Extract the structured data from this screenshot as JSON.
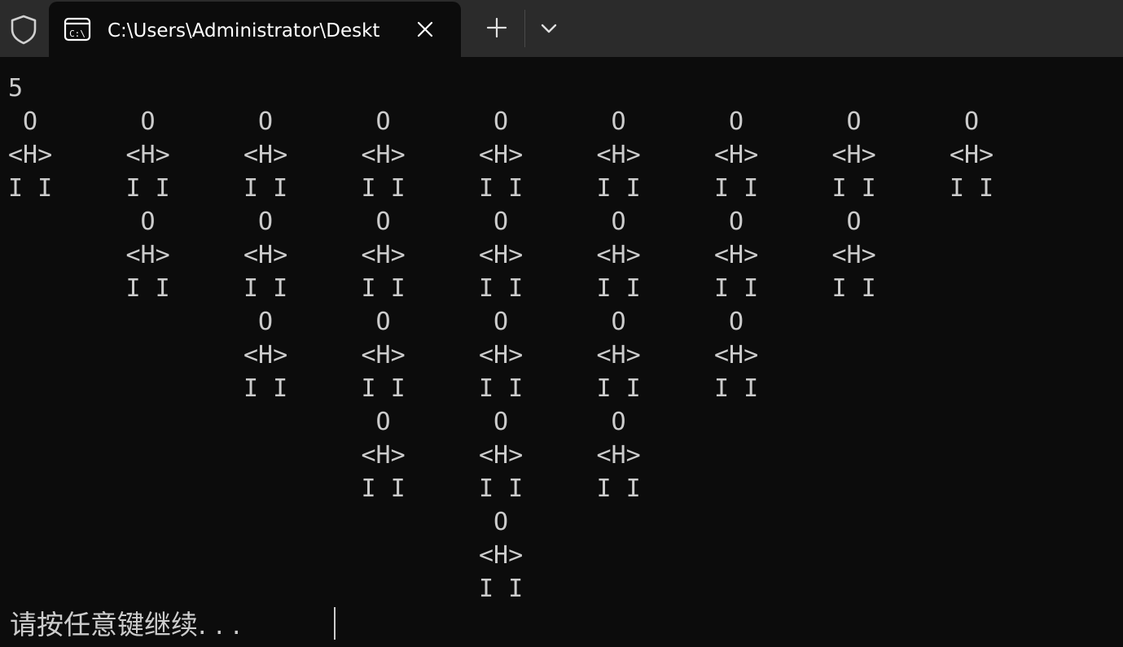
{
  "tab": {
    "icon": "terminal-icon",
    "title": "C:\\Users\\Administrator\\Deskt",
    "close_icon": "close-icon"
  },
  "titlebar": {
    "shield_icon": "shield-icon",
    "new_tab_icon": "plus-icon",
    "dropdown_icon": "chevron-down-icon",
    "background": "#2b2b2b"
  },
  "console": {
    "background": "#0c0c0c",
    "foreground": "#cccccc",
    "lines": [
      "5",
      " O       O       O       O       O       O       O       O       O",
      "<H>     <H>     <H>     <H>     <H>     <H>     <H>     <H>     <H>",
      "I I     I I     I I     I I     I I     I I     I I     I I     I I",
      "         O       O       O       O       O       O       O",
      "        <H>     <H>     <H>     <H>     <H>     <H>     <H>",
      "        I I     I I     I I     I I     I I     I I     I I",
      "                 O       O       O       O       O",
      "                <H>     <H>     <H>     <H>     <H>",
      "                I I     I I     I I     I I     I I",
      "                         O       O       O",
      "                        <H>     <H>     <H>",
      "                        I I     I I     I I",
      "                                 O",
      "                                <H>",
      "                                I I"
    ],
    "prompt": "请按任意键继续. . ."
  }
}
